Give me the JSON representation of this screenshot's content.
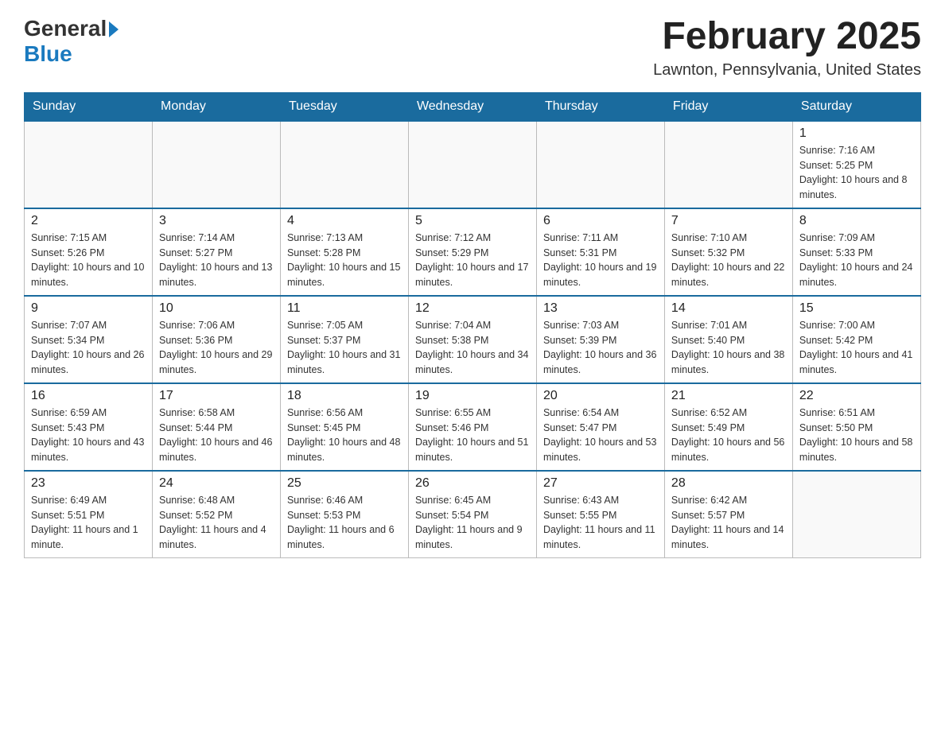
{
  "header": {
    "logo_general": "General",
    "logo_blue": "Blue",
    "month_title": "February 2025",
    "location": "Lawnton, Pennsylvania, United States"
  },
  "days_of_week": [
    "Sunday",
    "Monday",
    "Tuesday",
    "Wednesday",
    "Thursday",
    "Friday",
    "Saturday"
  ],
  "weeks": [
    [
      {
        "day": "",
        "info": ""
      },
      {
        "day": "",
        "info": ""
      },
      {
        "day": "",
        "info": ""
      },
      {
        "day": "",
        "info": ""
      },
      {
        "day": "",
        "info": ""
      },
      {
        "day": "",
        "info": ""
      },
      {
        "day": "1",
        "info": "Sunrise: 7:16 AM\nSunset: 5:25 PM\nDaylight: 10 hours and 8 minutes."
      }
    ],
    [
      {
        "day": "2",
        "info": "Sunrise: 7:15 AM\nSunset: 5:26 PM\nDaylight: 10 hours and 10 minutes."
      },
      {
        "day": "3",
        "info": "Sunrise: 7:14 AM\nSunset: 5:27 PM\nDaylight: 10 hours and 13 minutes."
      },
      {
        "day": "4",
        "info": "Sunrise: 7:13 AM\nSunset: 5:28 PM\nDaylight: 10 hours and 15 minutes."
      },
      {
        "day": "5",
        "info": "Sunrise: 7:12 AM\nSunset: 5:29 PM\nDaylight: 10 hours and 17 minutes."
      },
      {
        "day": "6",
        "info": "Sunrise: 7:11 AM\nSunset: 5:31 PM\nDaylight: 10 hours and 19 minutes."
      },
      {
        "day": "7",
        "info": "Sunrise: 7:10 AM\nSunset: 5:32 PM\nDaylight: 10 hours and 22 minutes."
      },
      {
        "day": "8",
        "info": "Sunrise: 7:09 AM\nSunset: 5:33 PM\nDaylight: 10 hours and 24 minutes."
      }
    ],
    [
      {
        "day": "9",
        "info": "Sunrise: 7:07 AM\nSunset: 5:34 PM\nDaylight: 10 hours and 26 minutes."
      },
      {
        "day": "10",
        "info": "Sunrise: 7:06 AM\nSunset: 5:36 PM\nDaylight: 10 hours and 29 minutes."
      },
      {
        "day": "11",
        "info": "Sunrise: 7:05 AM\nSunset: 5:37 PM\nDaylight: 10 hours and 31 minutes."
      },
      {
        "day": "12",
        "info": "Sunrise: 7:04 AM\nSunset: 5:38 PM\nDaylight: 10 hours and 34 minutes."
      },
      {
        "day": "13",
        "info": "Sunrise: 7:03 AM\nSunset: 5:39 PM\nDaylight: 10 hours and 36 minutes."
      },
      {
        "day": "14",
        "info": "Sunrise: 7:01 AM\nSunset: 5:40 PM\nDaylight: 10 hours and 38 minutes."
      },
      {
        "day": "15",
        "info": "Sunrise: 7:00 AM\nSunset: 5:42 PM\nDaylight: 10 hours and 41 minutes."
      }
    ],
    [
      {
        "day": "16",
        "info": "Sunrise: 6:59 AM\nSunset: 5:43 PM\nDaylight: 10 hours and 43 minutes."
      },
      {
        "day": "17",
        "info": "Sunrise: 6:58 AM\nSunset: 5:44 PM\nDaylight: 10 hours and 46 minutes."
      },
      {
        "day": "18",
        "info": "Sunrise: 6:56 AM\nSunset: 5:45 PM\nDaylight: 10 hours and 48 minutes."
      },
      {
        "day": "19",
        "info": "Sunrise: 6:55 AM\nSunset: 5:46 PM\nDaylight: 10 hours and 51 minutes."
      },
      {
        "day": "20",
        "info": "Sunrise: 6:54 AM\nSunset: 5:47 PM\nDaylight: 10 hours and 53 minutes."
      },
      {
        "day": "21",
        "info": "Sunrise: 6:52 AM\nSunset: 5:49 PM\nDaylight: 10 hours and 56 minutes."
      },
      {
        "day": "22",
        "info": "Sunrise: 6:51 AM\nSunset: 5:50 PM\nDaylight: 10 hours and 58 minutes."
      }
    ],
    [
      {
        "day": "23",
        "info": "Sunrise: 6:49 AM\nSunset: 5:51 PM\nDaylight: 11 hours and 1 minute."
      },
      {
        "day": "24",
        "info": "Sunrise: 6:48 AM\nSunset: 5:52 PM\nDaylight: 11 hours and 4 minutes."
      },
      {
        "day": "25",
        "info": "Sunrise: 6:46 AM\nSunset: 5:53 PM\nDaylight: 11 hours and 6 minutes."
      },
      {
        "day": "26",
        "info": "Sunrise: 6:45 AM\nSunset: 5:54 PM\nDaylight: 11 hours and 9 minutes."
      },
      {
        "day": "27",
        "info": "Sunrise: 6:43 AM\nSunset: 5:55 PM\nDaylight: 11 hours and 11 minutes."
      },
      {
        "day": "28",
        "info": "Sunrise: 6:42 AM\nSunset: 5:57 PM\nDaylight: 11 hours and 14 minutes."
      },
      {
        "day": "",
        "info": ""
      }
    ]
  ]
}
